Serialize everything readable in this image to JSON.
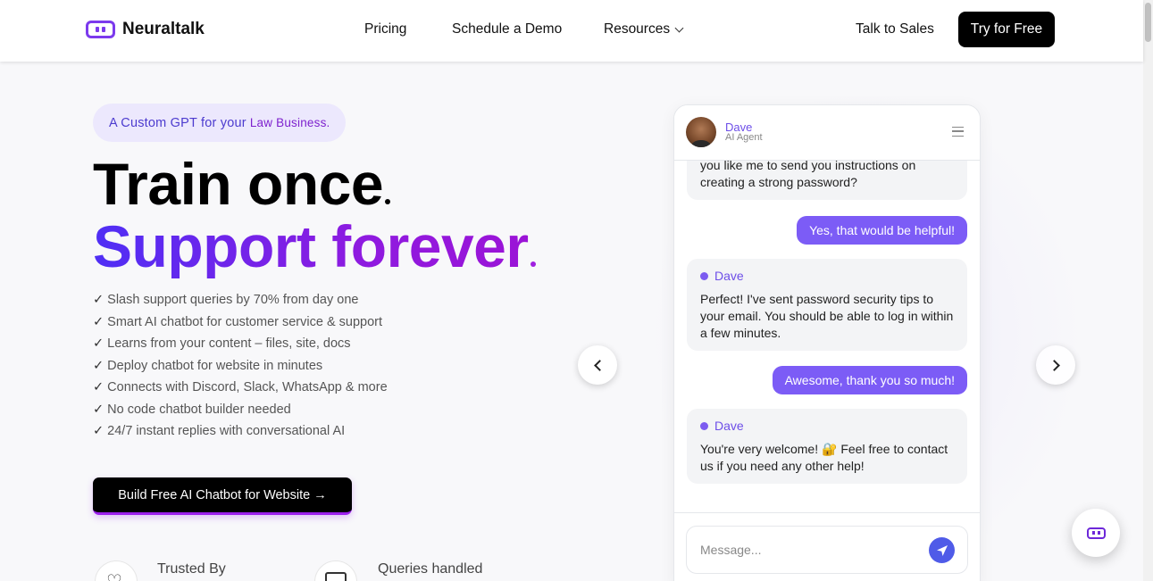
{
  "nav": {
    "brand": "Neuraltalk",
    "links": [
      "Pricing",
      "Schedule a Demo",
      "Resources"
    ],
    "talk_sales": "Talk to Sales",
    "try_free": "Try for Free"
  },
  "hero": {
    "pill_prefix": "A Custom GPT for your",
    "pill_business": "Law Business",
    "pill_suffix": ".",
    "title_line1": "Train once",
    "title_line2": "Support forever",
    "features": [
      "Slash support queries by 70% from day one",
      "Smart AI chatbot for customer service & support",
      "Learns from your content – files, site, docs",
      "Deploy chatbot for website in minutes",
      "Connects with Discord, Slack, WhatsApp & more",
      "No code chatbot builder needed",
      "24/7 instant replies with conversational AI"
    ],
    "check": "✓",
    "cta": "Build Free AI Chatbot for Website →",
    "stats": [
      "Trusted By",
      "Queries handled"
    ]
  },
  "chat": {
    "agent_name": "Dave",
    "agent_role": "AI Agent",
    "messages": [
      {
        "text": "you like me to send you instructions on creating a strong password?"
      },
      {
        "text": "Yes, that would be helpful!"
      },
      {
        "sender": "Dave",
        "text": "Perfect! I've sent password security tips to your email. You should be able to log in within a few minutes."
      },
      {
        "text": "Awesome, thank you so much!"
      },
      {
        "sender": "Dave",
        "text": "You're very welcome! 🔐 Feel free to contact us if you need any other help!"
      }
    ],
    "input_placeholder": "Message..."
  },
  "colors": {
    "accent": "#7c5cf6",
    "brand": "#7c3aed",
    "gradient_start": "#4f2ff5",
    "gradient_end": "#9c13d6"
  }
}
